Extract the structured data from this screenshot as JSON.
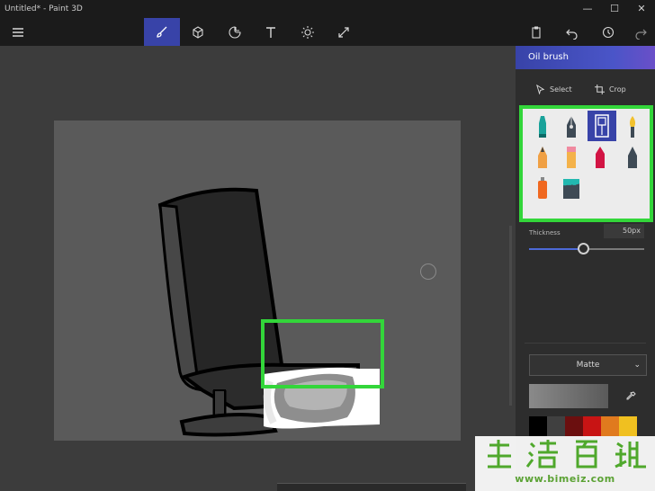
{
  "window": {
    "title": "Untitled* - Paint 3D",
    "minimize_glyph": "—",
    "maximize_glyph": "☐",
    "close_glyph": "✕"
  },
  "toolbar": {
    "menu_icon": "hamburger-icon",
    "tools": [
      {
        "name": "brushes",
        "icon": "brush-icon",
        "active": true
      },
      {
        "name": "3d-shapes",
        "icon": "cube-icon",
        "active": false
      },
      {
        "name": "stickers",
        "icon": "sticker-icon",
        "active": false
      },
      {
        "name": "text",
        "icon": "text-icon",
        "active": false
      },
      {
        "name": "effects",
        "icon": "sun-icon",
        "active": false
      },
      {
        "name": "canvas",
        "icon": "resize-icon",
        "active": false
      }
    ],
    "right_tools": [
      "paste-icon",
      "undo-icon",
      "history-icon",
      "redo-icon"
    ]
  },
  "panel": {
    "title": "Oil brush",
    "select_label": "Select",
    "crop_label": "Crop",
    "brushes": [
      {
        "name": "marker",
        "icon": "marker-icon",
        "selected": false
      },
      {
        "name": "calligraphy-pen",
        "icon": "pen-icon",
        "selected": false
      },
      {
        "name": "oil-brush",
        "icon": "oil-brush-icon",
        "selected": true
      },
      {
        "name": "watercolor",
        "icon": "watercolor-icon",
        "selected": false
      },
      {
        "name": "pixel-pen",
        "icon": "pencil-icon",
        "selected": false
      },
      {
        "name": "pencil",
        "icon": "pencil-eraser-icon",
        "selected": false
      },
      {
        "name": "crayon",
        "icon": "crayon-icon",
        "selected": false
      },
      {
        "name": "eraser",
        "icon": "eraser-icon",
        "selected": false
      },
      {
        "name": "spray-can",
        "icon": "spray-can-icon",
        "selected": false
      },
      {
        "name": "fill",
        "icon": "fill-bucket-icon",
        "selected": false
      }
    ],
    "thickness_label": "Thickness",
    "thickness_value": "50px",
    "thickness_fraction": 0.47,
    "finish_value": "Matte",
    "palette": [
      "#000000",
      "#404040",
      "#6b0f0f",
      "#c81414",
      "#e07a1e",
      "#f0c020"
    ]
  },
  "colors": {
    "accent": "#3843a8",
    "highlight": "#33d63a"
  },
  "watermark": {
    "chars": [
      "生",
      "活",
      "百",
      "科"
    ],
    "url": "www.bimeiz.com"
  }
}
